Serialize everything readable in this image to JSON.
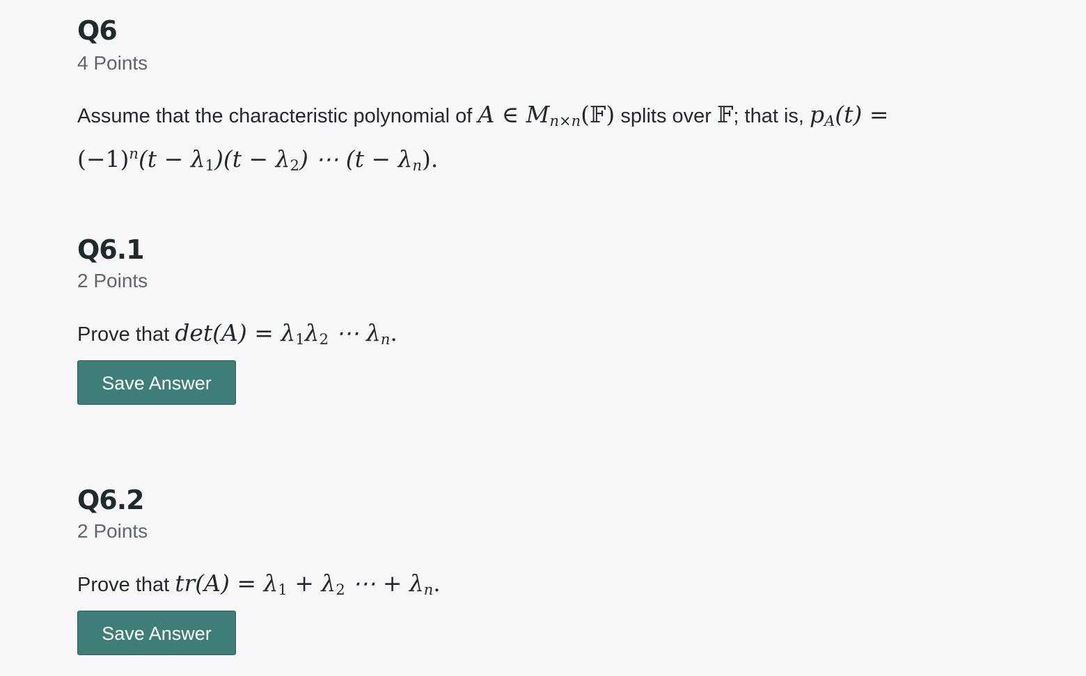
{
  "q6": {
    "title": "Q6",
    "points": "4 Points",
    "intro_text": "Assume that the characteristic polynomial of",
    "math_membership": "A ∈ M",
    "math_sub_nxn": "n×n",
    "math_field": "(𝔽)",
    "mid_text": "splits over",
    "field_symbol": "𝔽",
    "that_is_text": "; that is,",
    "math_pA": "p",
    "math_sub_A": "A",
    "math_pA_tail": "(t) =",
    "line2_a": "(−1)",
    "line2_sup_n": "n",
    "line2_b": "(t − λ",
    "line2_sub_1": "1",
    "line2_c": ")(t − λ",
    "line2_sub_2": "2",
    "line2_d": ") ⋯ (t − λ",
    "line2_sub_n": "n",
    "line2_e": ")."
  },
  "q6_1": {
    "title": "Q6.1",
    "points": "2 Points",
    "prompt_text": "Prove that",
    "math_det": "det(A) = λ",
    "sub_1": "1",
    "math_lambda2": "λ",
    "sub_2": "2",
    "math_dots": " ⋯ λ",
    "sub_n": "n",
    "math_end": ".",
    "save_label": "Save Answer"
  },
  "q6_2": {
    "title": "Q6.2",
    "points": "2 Points",
    "prompt_text": "Prove that",
    "math_tr": "tr(A) = λ",
    "sub_1": "1",
    "math_plus": " + λ",
    "sub_2": "2",
    "math_dots": " ⋯ + λ",
    "sub_n": "n",
    "math_end": ".",
    "save_label": "Save Answer"
  }
}
